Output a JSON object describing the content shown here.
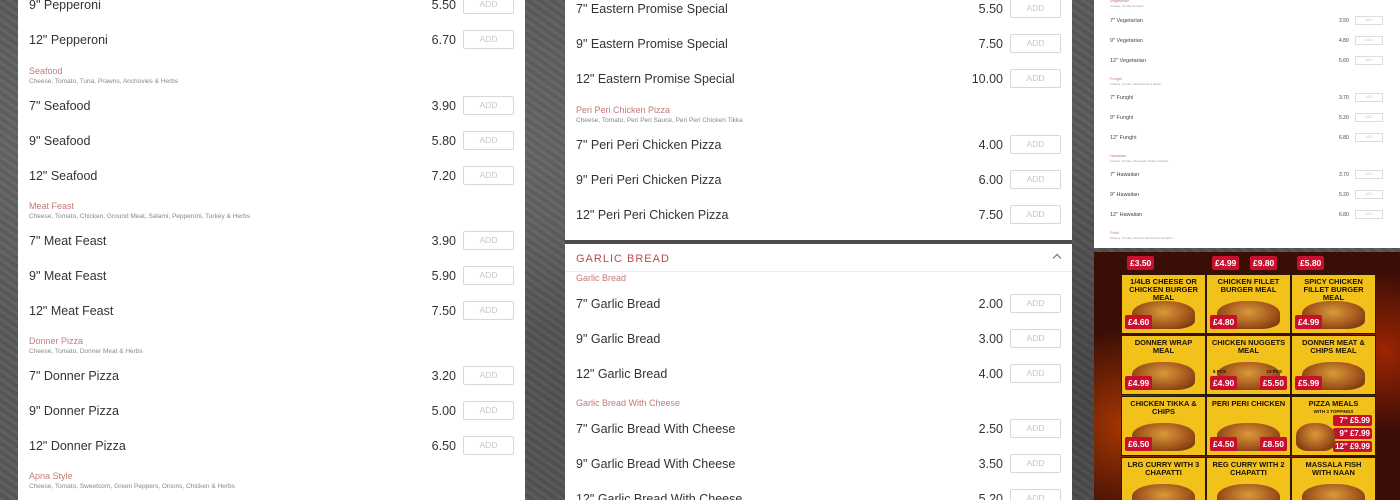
{
  "add_label": "ADD",
  "left_panel": {
    "items_top": [
      {
        "name": "9\" Pepperoni",
        "price": "5.50"
      },
      {
        "name": "12\" Pepperoni",
        "price": "6.70"
      }
    ],
    "groups": [
      {
        "title": "Seafood",
        "desc": "Cheese, Tomato, Tuna, Prawns, Anchovies & Herbs",
        "items": [
          {
            "name": "7\" Seafood",
            "price": "3.90"
          },
          {
            "name": "9\" Seafood",
            "price": "5.80"
          },
          {
            "name": "12\" Seafood",
            "price": "7.20"
          }
        ]
      },
      {
        "title": "Meat Feast",
        "desc": "Cheese, Tomato, Chicken, Ground Meat, Salami, Pepperoni, Turkey & Herbs",
        "items": [
          {
            "name": "7\" Meat Feast",
            "price": "3.90"
          },
          {
            "name": "9\" Meat Feast",
            "price": "5.90"
          },
          {
            "name": "12\" Meat Feast",
            "price": "7.50"
          }
        ]
      },
      {
        "title": "Donner Pizza",
        "desc": "Cheese, Tomato, Donner Meat & Herbs",
        "items": [
          {
            "name": "7\" Donner Pizza",
            "price": "3.20"
          },
          {
            "name": "9\" Donner Pizza",
            "price": "5.00"
          },
          {
            "name": "12\" Donner Pizza",
            "price": "6.50"
          }
        ]
      },
      {
        "title": "Apna Style",
        "desc": "Cheese, Tomato, Sweetcorn, Green Peppers, Onions, Chicken & Herbs",
        "items": []
      }
    ]
  },
  "mid_top": {
    "items_top": [
      {
        "name": "7\" Eastern Promise Special",
        "price": "5.50"
      },
      {
        "name": "9\" Eastern Promise Special",
        "price": "7.50"
      },
      {
        "name": "12\" Eastern Promise Special",
        "price": "10.00"
      }
    ],
    "group": {
      "title": "Peri Peri Chicken Pizza",
      "desc": "Cheese, Tomato, Peri Peri Sauce, Peri Peri Chicken Tikka",
      "items": [
        {
          "name": "7\" Peri Peri Chicken Pizza",
          "price": "4.00"
        },
        {
          "name": "9\" Peri Peri Chicken Pizza",
          "price": "6.00"
        },
        {
          "name": "12\" Peri Peri Chicken Pizza",
          "price": "7.50"
        }
      ]
    }
  },
  "mid_bottom": {
    "section_title": "GARLIC BREAD",
    "groups": [
      {
        "title": "Garlic Bread",
        "items": [
          {
            "name": "7\" Garlic Bread",
            "price": "2.00"
          },
          {
            "name": "9\" Garlic Bread",
            "price": "3.00"
          },
          {
            "name": "12\" Garlic Bread",
            "price": "4.00"
          }
        ]
      },
      {
        "title": "Garlic Bread With Cheese",
        "items": [
          {
            "name": "7\" Garlic Bread With Cheese",
            "price": "2.50"
          },
          {
            "name": "9\" Garlic Bread With Cheese",
            "price": "3.50"
          },
          {
            "name": "12\" Garlic Bread With Cheese",
            "price": "5.20"
          }
        ]
      }
    ]
  },
  "thumb": {
    "top_title": "Vegetarian",
    "top_desc": "Cheese, Tomato & Herbs",
    "rows": [
      {
        "kind": "item",
        "name": "7\" Vegetarian",
        "price": "3.50"
      },
      {
        "kind": "item",
        "name": "9\" Vegetarian",
        "price": "4.80"
      },
      {
        "kind": "item",
        "name": "12\" Vegetarian",
        "price": "5.60"
      },
      {
        "kind": "title",
        "name": "Funghi",
        "desc": "Cheese, Tomato, Mushrooms & Herbs"
      },
      {
        "kind": "item",
        "name": "7\" Funghi",
        "price": "3.70"
      },
      {
        "kind": "item",
        "name": "9\" Funghi",
        "price": "5.20"
      },
      {
        "kind": "item",
        "name": "12\" Funghi",
        "price": "6.80"
      },
      {
        "kind": "title",
        "name": "Hawaiian",
        "desc": "Cheese, Tomato, Pineapple Turkey & Herbs"
      },
      {
        "kind": "item",
        "name": "7\" Hawaiian",
        "price": "3.70"
      },
      {
        "kind": "item",
        "name": "9\" Hawaiian",
        "price": "5.20"
      },
      {
        "kind": "item",
        "name": "12\" Hawaiian",
        "price": "6.80"
      },
      {
        "kind": "title",
        "name": "Pollo",
        "desc": "Cheese, Tomato, Chicken Mushrooms & Herbs"
      }
    ]
  },
  "poster": {
    "row0": [
      "£3.50",
      "£4.99",
      "£9.80",
      "£5.80"
    ],
    "cells": [
      {
        "name": "1/4LB CHEESE OR CHICKEN BURGER MEAL",
        "price": "£4.60"
      },
      {
        "name": "CHICKEN FILLET BURGER MEAL",
        "price": "£4.80"
      },
      {
        "name": "SPICY CHICKEN FILLET BURGER MEAL",
        "price": "£4.99"
      },
      {
        "name": "DONNER WRAP MEAL",
        "price": "£4.99"
      },
      {
        "name": "CHICKEN NUGGETS MEAL",
        "price": "£4.90",
        "price2": "£5.50",
        "tag1": "6 PCS",
        "tag2": "10 PCS"
      },
      {
        "name": "DONNER MEAT & CHIPS MEAL",
        "price": "£5.99"
      },
      {
        "name": "CHICKEN TIKKA & CHIPS",
        "price": "£6.50"
      },
      {
        "name": "PERI PERI CHICKEN",
        "price": "£4.50",
        "price2": "£8.50"
      },
      {
        "name": "PIZZA MEALS",
        "sub": "WITH 3 TOPPINGS",
        "list": [
          "7\" £5.99",
          "9\" £7.99",
          "12\" £9.99"
        ]
      },
      {
        "name": "LRG CURRY WITH 3 CHAPATTI"
      },
      {
        "name": "REG CURRY WITH 2 CHAPATTI"
      },
      {
        "name": "MASSALA FISH WITH NAAN"
      }
    ]
  }
}
